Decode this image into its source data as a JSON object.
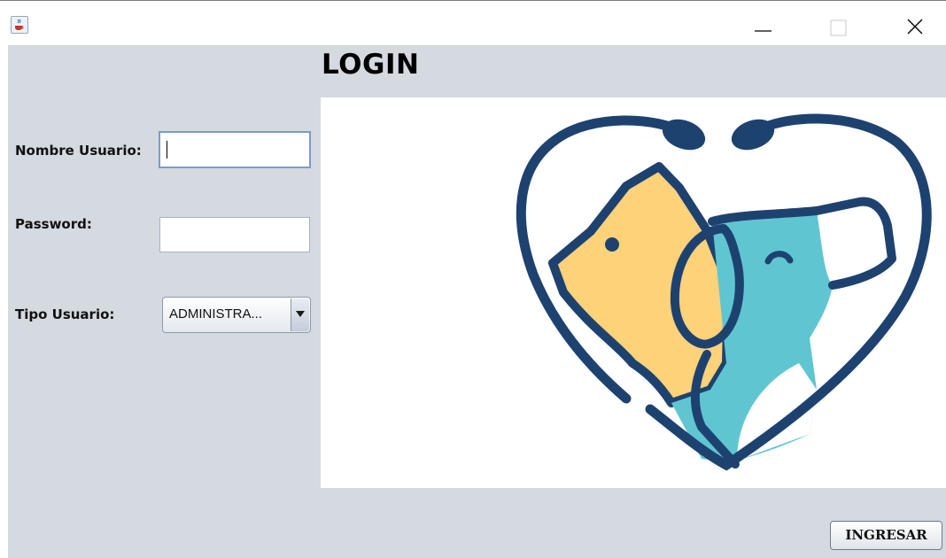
{
  "window": {
    "minimize_icon": "minimize-icon",
    "maximize_icon": "maximize-icon",
    "close_icon": "close-icon",
    "app_icon": "java-cup-icon"
  },
  "header": {
    "title": "LOGIN"
  },
  "form": {
    "username_label": "Nombre Usuario:",
    "username_value": "",
    "password_label": "Password:",
    "password_value": "",
    "user_type_label": "Tipo Usuario:",
    "user_type_value": "ADMINISTRA...",
    "user_type_icon": "dropdown-arrow-icon"
  },
  "logo": {
    "description_icon": "pet-heart-logo"
  },
  "actions": {
    "submit_label": "INGRESAR"
  },
  "colors": {
    "panel_bg": "#d5d9e0",
    "logo_navy": "#1e4270",
    "logo_yellow": "#fdd278",
    "logo_teal": "#5fc6d1"
  }
}
